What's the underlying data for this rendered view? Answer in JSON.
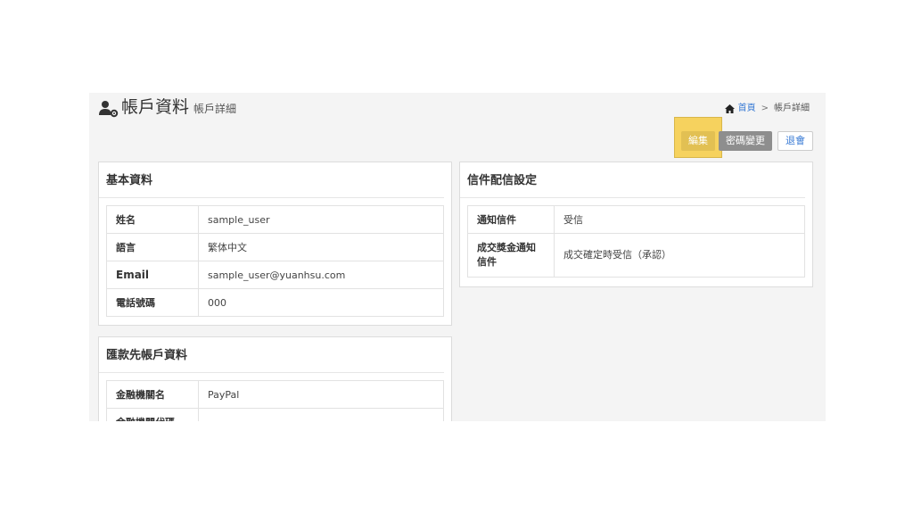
{
  "header": {
    "title": "帳戶資料",
    "subtitle": "帳戶詳細",
    "icon": "user-gear-icon"
  },
  "breadcrumb": {
    "home_label": "首頁",
    "separator": ">",
    "current": "帳戶詳細"
  },
  "actions": {
    "edit_label": "編集",
    "password_label": "密碼變更",
    "logout_label": "退會"
  },
  "basic_info": {
    "title": "基本資料",
    "rows": [
      {
        "label": "姓名",
        "value": "sample_user"
      },
      {
        "label": "語言",
        "value": "繁体中文"
      },
      {
        "label": "Email",
        "value": "sample_user@yuanhsu.com"
      },
      {
        "label": "電話號碼",
        "value": "000"
      }
    ]
  },
  "bank_info": {
    "title": "匯款先帳戶資料",
    "rows": [
      {
        "label": "金融機關名",
        "value": "PayPal"
      },
      {
        "label": "金融機關代碼",
        "value": ""
      }
    ]
  },
  "mail_settings": {
    "title": "信件配信設定",
    "rows": [
      {
        "label": "通知信件",
        "value": "受信"
      },
      {
        "label": "成交獎金通知信件",
        "value": "成交確定時受信（承認）"
      }
    ]
  },
  "colors": {
    "accent": "#f6d25e",
    "link": "#3a7bd5",
    "button_gray": "#8e8e8e"
  }
}
